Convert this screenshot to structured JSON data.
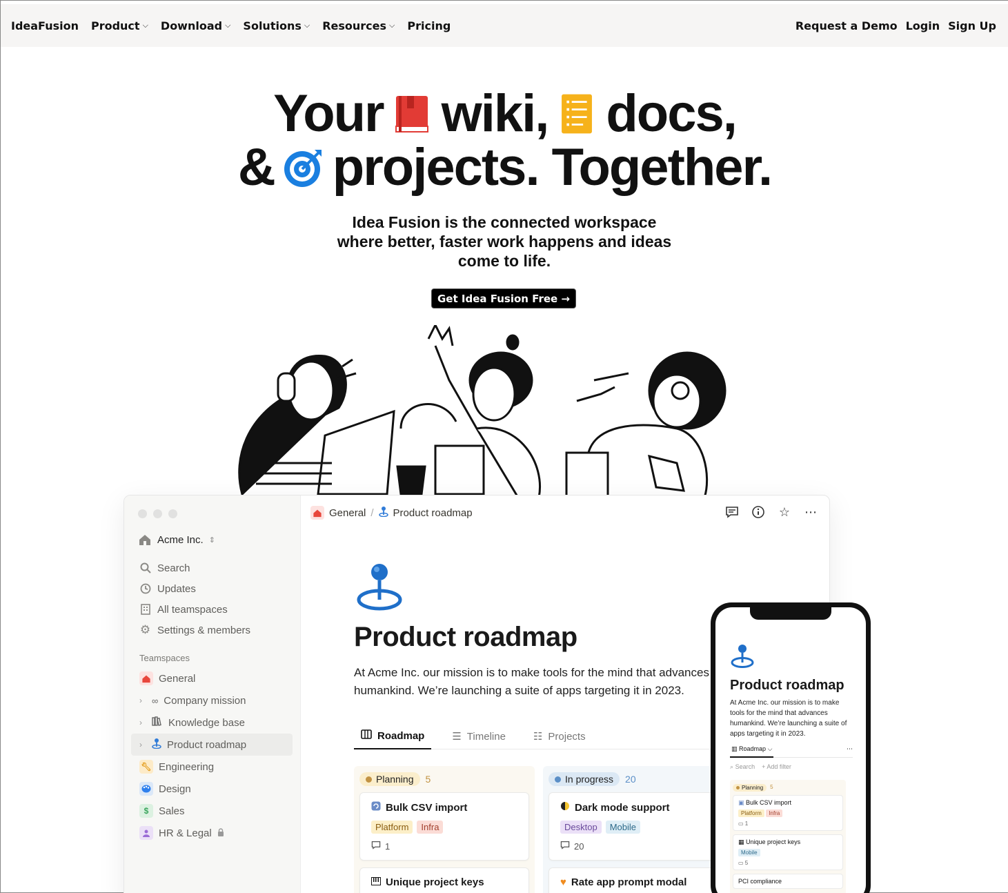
{
  "nav": {
    "brand": "IdeaFusion",
    "items": [
      {
        "label": "Product",
        "dropdown": true
      },
      {
        "label": "Download",
        "dropdown": true
      },
      {
        "label": "Solutions",
        "dropdown": true
      },
      {
        "label": "Resources",
        "dropdown": true
      },
      {
        "label": "Pricing",
        "dropdown": false
      }
    ],
    "right": [
      "Request a Demo",
      "Login",
      "Sign Up"
    ]
  },
  "hero": {
    "line1_a": "Your",
    "line1_b": "wiki,",
    "line1_c": "docs,",
    "line2_a": "&",
    "line2_b": "projects. Together.",
    "subtitle": "Idea Fusion is the connected workspace where better, faster work happens and ideas come to life.",
    "cta": "Get Idea Fusion Free →"
  },
  "app": {
    "workspace": "Acme Inc.",
    "side_items": [
      "Search",
      "Updates",
      "All teamspaces",
      "Settings & members"
    ],
    "teamspaces_label": "Teamspaces",
    "teamspaces": [
      {
        "label": "General",
        "icon": "home-icon",
        "color": "#e8473c",
        "expandable": false
      },
      {
        "label": "Company mission",
        "icon": "binoculars-icon",
        "expandable": true
      },
      {
        "label": "Knowledge base",
        "icon": "books-icon",
        "expandable": true
      },
      {
        "label": "Product roadmap",
        "icon": "pin-icon",
        "expandable": true,
        "active": true
      },
      {
        "label": "Engineering",
        "icon": "wrench-icon",
        "color": "#f5a623",
        "expandable": false
      },
      {
        "label": "Design",
        "icon": "palette-icon",
        "color": "#2f80ed",
        "expandable": false
      },
      {
        "label": "Sales",
        "icon": "dollar-icon",
        "color": "#3aa55d",
        "expandable": false
      },
      {
        "label": "HR & Legal",
        "icon": "person-icon",
        "color": "#9b6bd6",
        "expandable": false,
        "locked": true
      }
    ],
    "breadcrumb": [
      "General",
      "Product roadmap"
    ],
    "page_title": "Product roadmap",
    "page_desc": "At Acme Inc. our mission is to make tools for the mind that advances humankind. We’re launching a suite of apps targeting it in 2023.",
    "tabs": [
      "Roadmap",
      "Timeline",
      "Projects"
    ],
    "columns": [
      {
        "name": "Planning",
        "count": "5",
        "dot": "#c29343",
        "pill_bg": "#fbeecc",
        "count_color": "#c29343",
        "cards": [
          {
            "title": "Bulk CSV import",
            "tags": [
              "Platform",
              "Infra"
            ],
            "comments": "1"
          },
          {
            "title": "Unique project keys",
            "tags": [],
            "comments": ""
          }
        ]
      },
      {
        "name": "In progress",
        "count": "20",
        "dot": "#5b8fc7",
        "pill_bg": "#dbe8f4",
        "count_color": "#5b8fc7",
        "cards": [
          {
            "title": "Dark mode support",
            "tags": [
              "Desktop",
              "Mobile"
            ],
            "comments": "20"
          },
          {
            "title": "Rate app prompt modal",
            "tags": [],
            "comments": ""
          }
        ]
      }
    ]
  },
  "phone": {
    "title": "Product roadmap",
    "desc": "At Acme Inc. our mission is to make tools for the mind that advances humankind. We’re launching a suite of apps targeting it in 2023.",
    "tab": "Roadmap",
    "search": "Search",
    "filter": "+ Add filter",
    "col_name": "Planning",
    "col_count": "5",
    "card1": "Bulk CSV import",
    "card1_tags": [
      "Platform",
      "Infra"
    ],
    "card1_comments": "1",
    "card2": "Unique project keys",
    "card2_tag": "Mobile",
    "card2_comments": "5",
    "card3": "PCI compliance"
  }
}
